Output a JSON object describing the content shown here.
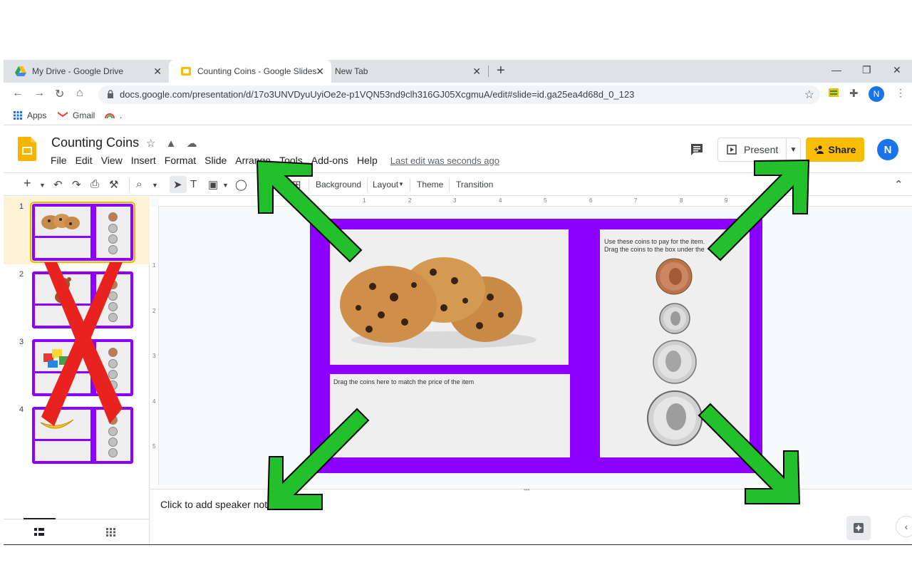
{
  "browser": {
    "tabs": [
      {
        "title": "My Drive - Google Drive",
        "icon": "google-drive-icon",
        "active": false
      },
      {
        "title": "Counting Coins - Google Slides",
        "icon": "google-slides-icon",
        "active": true
      },
      {
        "title": "New Tab",
        "icon": "",
        "active": false
      }
    ],
    "url": "docs.google.com/presentation/d/17o3UNVDyuUyiOe2e-p1VQN53nd9clh316GJ05XcgmuA/edit#slide=id.ga25ea4d68d_0_123",
    "account_initial": "N",
    "bookmarks": [
      {
        "label": "Apps",
        "icon": "apps-grid-icon"
      },
      {
        "label": "Gmail",
        "icon": "gmail-icon"
      },
      {
        "label": ".",
        "icon": "rainbow-icon"
      }
    ]
  },
  "app": {
    "title": "Counting Coins",
    "menu": [
      "File",
      "Edit",
      "View",
      "Insert",
      "Format",
      "Slide",
      "Arrange",
      "Tools",
      "Add-ons",
      "Help"
    ],
    "last_edit": "Last edit was seconds ago",
    "present_label": "Present",
    "share_label": "Share",
    "account_initial": "N",
    "brand_color": "#fbbc04"
  },
  "toolbar": {
    "background_label": "Background",
    "layout_label": "Layout",
    "theme_label": "Theme",
    "transition_label": "Transition"
  },
  "filmstrip": {
    "slides": [
      {
        "number": "1",
        "image": "cookies",
        "selected": true
      },
      {
        "number": "2",
        "image": "teddy-bear",
        "selected": false
      },
      {
        "number": "3",
        "image": "lego-blocks",
        "selected": false
      },
      {
        "number": "4",
        "image": "banana",
        "selected": false
      }
    ]
  },
  "slide": {
    "background_color": "#8b00ff",
    "image": "chocolate-chip-cookies",
    "drop_zone_text": "Drag the coins here to match the price of the item",
    "coin_instructions_line1": "Use these coins to pay for the item.",
    "coin_instructions_line2": "Drag the coins  to the box under the",
    "coins": [
      "penny",
      "dime",
      "nickel",
      "quarter"
    ]
  },
  "notes": {
    "placeholder": "Click to add speaker notes"
  },
  "overlay": {
    "arrows": [
      "top-left",
      "top-right",
      "bottom-left",
      "bottom-right"
    ],
    "arrow_color": "#22c02a",
    "cross_color": "#e8231f"
  },
  "ruler": {
    "h_ticks": [
      "1",
      "2",
      "3",
      "4",
      "5",
      "6",
      "7",
      "8",
      "9"
    ],
    "v_ticks": [
      "1",
      "2",
      "3",
      "4",
      "5"
    ]
  }
}
